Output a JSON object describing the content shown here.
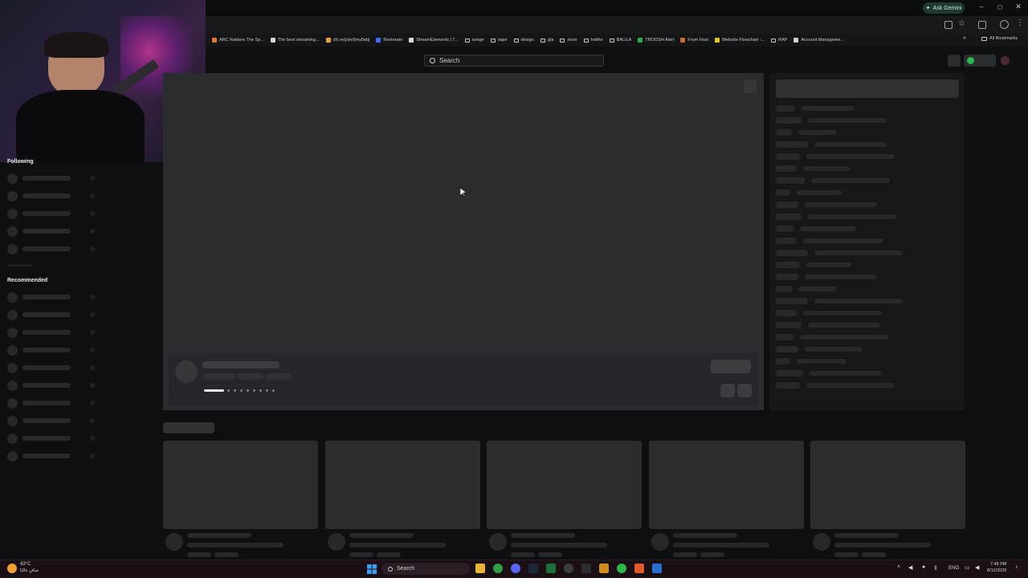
{
  "browser": {
    "gemini_label": "Ask Gemini",
    "window_controls": [
      "–",
      "▢",
      "✕"
    ],
    "bookmarks": [
      {
        "label": "ARC Raiders The Sp...",
        "color": "#e07a2f"
      },
      {
        "label": "The best streaming...",
        "color": "#d9d9d9"
      },
      {
        "label": "cfx.re/join/6my5ebj",
        "color": "#e8a23c"
      },
      {
        "label": "Restream",
        "color": "#3b6ee8"
      },
      {
        "label": "StreamElements | T...",
        "color": "#d9d9d9"
      },
      {
        "label": "songe",
        "color": "folder"
      },
      {
        "label": "vape",
        "color": "folder"
      },
      {
        "label": "design",
        "color": "folder"
      },
      {
        "label": "gta",
        "color": "folder"
      },
      {
        "label": "store",
        "color": "folder"
      },
      {
        "label": "heithe",
        "color": "folder"
      },
      {
        "label": "BALILA",
        "color": "folder"
      },
      {
        "label": "TROOSH Alert",
        "color": "#2fae4a"
      },
      {
        "label": "From Host",
        "color": "#c96a2a"
      },
      {
        "label": "Website Flowchart -...",
        "color": "#e8c21c"
      },
      {
        "label": "RAP",
        "color": "folder"
      },
      {
        "label": "Account Manageme...",
        "color": "#cfcfcf"
      }
    ],
    "more_chevron": "»",
    "all_bookmarks_label": "All Bookmarks"
  },
  "site": {
    "search_placeholder": "Search",
    "sidebar": {
      "following_label": "Following",
      "recommended_label": "Recommended"
    }
  },
  "taskbar": {
    "weather_temp": "43°C",
    "weather_desc": "صافٍ غالبًا",
    "search_label": "Search",
    "language": "ENG",
    "time": "7:48 PM",
    "date": "8/12/2026"
  },
  "colors": {
    "accent_live": "#2fb84a",
    "placeholder": "#26292b"
  }
}
